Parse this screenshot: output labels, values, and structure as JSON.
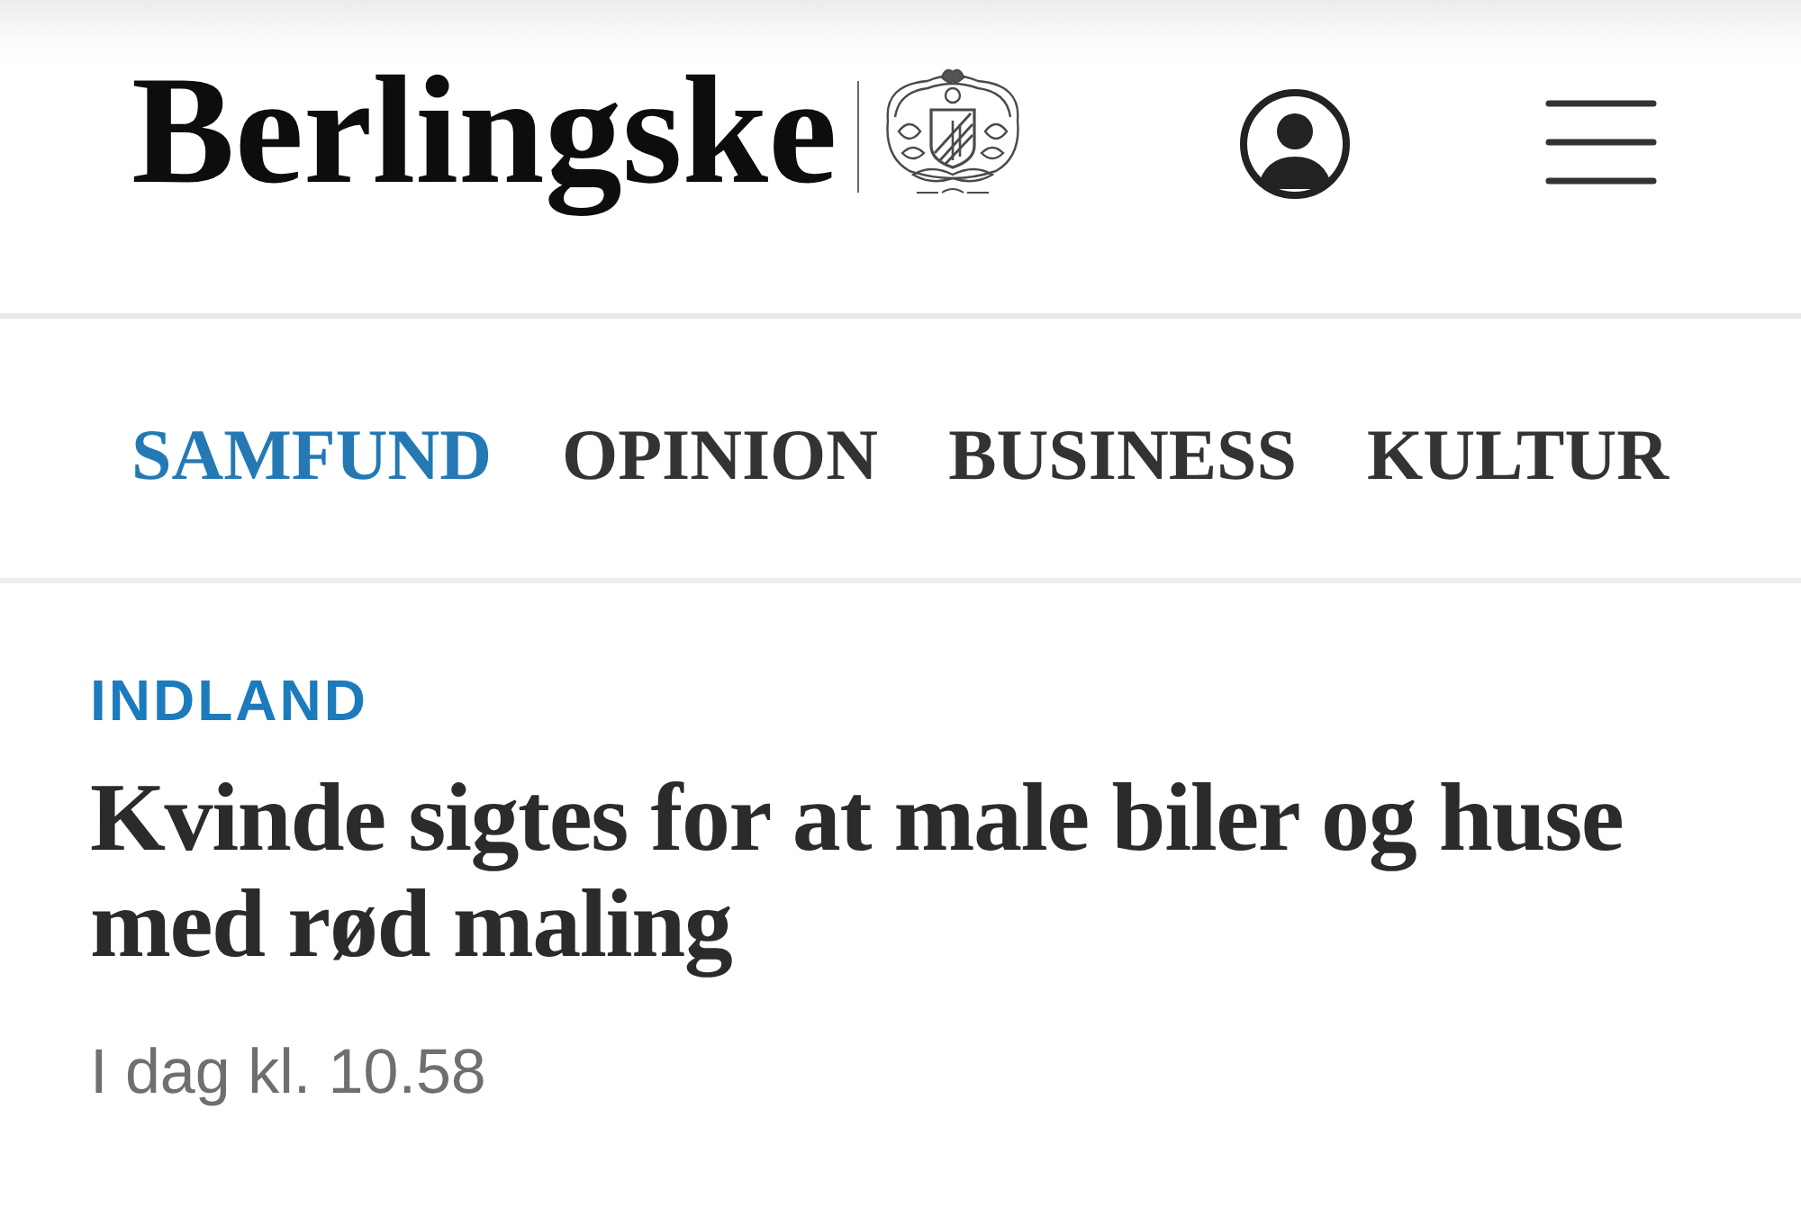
{
  "header": {
    "logo": {
      "wordmark": "Berlingske"
    }
  },
  "nav": {
    "items": [
      {
        "label": "SAMFUND",
        "selected": true
      },
      {
        "label": "OPINION",
        "selected": false
      },
      {
        "label": "BUSINESS",
        "selected": false
      },
      {
        "label": "KULTUR",
        "selected": false
      }
    ]
  },
  "article": {
    "section": "INDLAND",
    "headline": "Kvinde sigtes for at male biler og huse med rød maling",
    "timestamp": "I dag kl. 10.58"
  }
}
